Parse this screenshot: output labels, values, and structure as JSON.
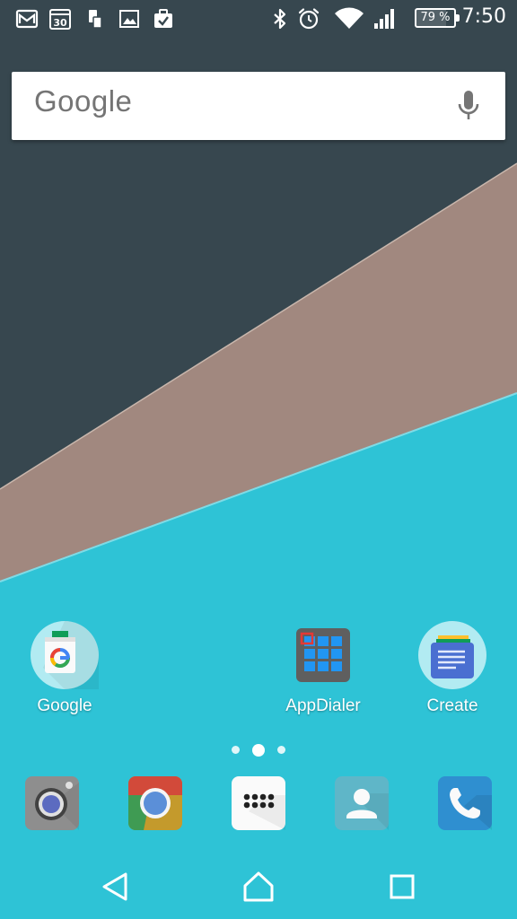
{
  "status_bar": {
    "icons": [
      "gmail-icon",
      "calendar-icon",
      "device-icon",
      "gallery-icon",
      "briefcase-icon",
      "bluetooth-icon",
      "alarm-icon",
      "wifi-icon",
      "signal-icon"
    ],
    "calendar_day": "30",
    "battery_text": "79 %",
    "battery_level": 79,
    "time": "7:50"
  },
  "search": {
    "logo_text": "Google",
    "icon": "mic-icon"
  },
  "home_apps": [
    {
      "label": "Google",
      "icon": "google-app-icon"
    },
    {
      "label": "AppDialer",
      "icon": "appdialer-icon"
    },
    {
      "label": "Create",
      "icon": "create-docs-icon"
    }
  ],
  "pages": {
    "count": 3,
    "active": 1
  },
  "dock": [
    "camera-icon",
    "chrome-icon",
    "app-drawer-icon",
    "contacts-icon",
    "phone-icon"
  ],
  "nav": [
    "back-icon",
    "home-icon",
    "recents-icon"
  ],
  "colors": {
    "wallpaper_dark": "#37474f",
    "wallpaper_taupe": "#a1887f",
    "wallpaper_cyan": "#2ec3d6"
  }
}
